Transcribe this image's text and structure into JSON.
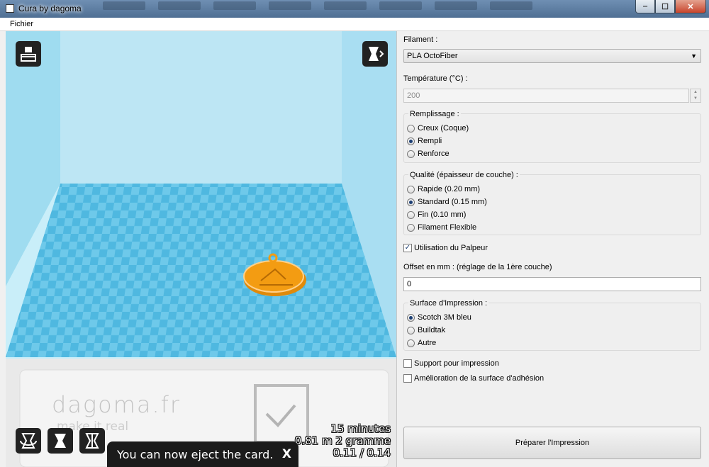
{
  "window": {
    "title": "Cura by dagoma",
    "min": "‒",
    "max": "☐",
    "close": "✕"
  },
  "menu": {
    "file": "Fichier"
  },
  "viewport": {
    "brand": "dagoma.fr",
    "brand_sub": "make it real",
    "stats": [
      "15 minutes",
      "0.81 m 2 gramme",
      "0.11 / 0.14"
    ],
    "toast": "You can now eject the card.",
    "toast_close": "X",
    "object_color": "#f39c12",
    "bed_color": "#4fb8e0"
  },
  "panel": {
    "filament_label": "Filament :",
    "filament_value": "PLA OctoFiber",
    "temp_label": "Température (°C) :",
    "temp_value": "200",
    "infill": {
      "title": "Remplissage :",
      "options": [
        "Creux (Coque)",
        "Rempli",
        "Renforce"
      ],
      "selected": 1
    },
    "quality": {
      "title": "Qualité (épaisseur de couche) :",
      "options": [
        "Rapide (0.20 mm)",
        "Standard (0.15 mm)",
        "Fin (0.10 mm)",
        "Filament Flexible"
      ],
      "selected": 1
    },
    "probe_label": "Utilisation du Palpeur",
    "probe_checked": true,
    "offset_label": "Offset en mm : (réglage de la 1ère couche)",
    "offset_value": "0",
    "surface": {
      "title": "Surface d'Impression :",
      "options": [
        "Scotch 3M bleu",
        "Buildtak",
        "Autre"
      ],
      "selected": 0
    },
    "support_label": "Support pour impression",
    "support_checked": false,
    "adhesion_label": "Amélioration de la surface d'adhésion",
    "adhesion_checked": false,
    "prepare_button": "Préparer l'Impression"
  }
}
